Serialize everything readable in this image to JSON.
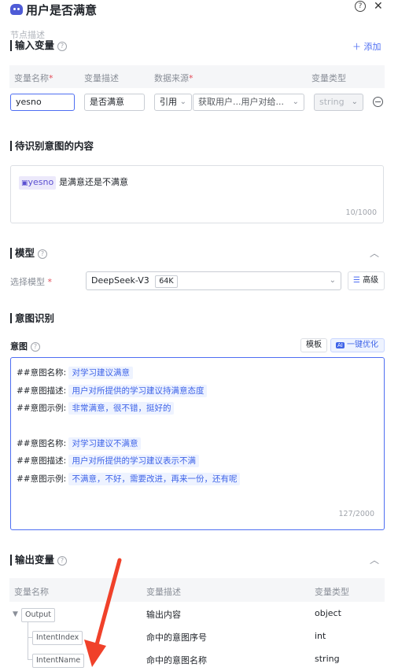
{
  "header": {
    "title": "用户是否满意",
    "subtitle": "节点描述",
    "help_icon": "question-circle-icon",
    "close_icon": "close-icon"
  },
  "input_section": {
    "title": "输入变量",
    "add_label": "添加",
    "columns": [
      "变量名称",
      "变量描述",
      "数据来源",
      "变量类型"
    ],
    "row": {
      "name": "yesno",
      "description": "是否满意",
      "source_mode": "引用",
      "source_value": "获取用户...用户对给...",
      "type_placeholder": "string"
    }
  },
  "query_section": {
    "title": "待识别意图的内容",
    "var_tag": "yesno",
    "text": "是满意还是不满意",
    "counter": "10/1000"
  },
  "model_section": {
    "title": "模型",
    "select_label": "选择模型",
    "model_name": "DeepSeek-V3",
    "context_badge": "64K",
    "advanced_label": "高级"
  },
  "intent_section": {
    "title": "意图识别",
    "intent_label": "意图",
    "template_btn": "模板",
    "optimize_btn": "一键优化",
    "ai_badge": "AI",
    "lines": [
      {
        "label": "##意图名称:",
        "value": "对学习建议满意"
      },
      {
        "label": "##意图描述:",
        "value": "用户对所提供的学习建议持满意态度"
      },
      {
        "label": "##意图示例:",
        "value": "非常满意，很不错，挺好的"
      },
      {
        "label": "##意图名称:",
        "value": "对学习建议不满意"
      },
      {
        "label": "##意图描述:",
        "value": "用户对所提供的学习建议表示不满"
      },
      {
        "label": "##意图示例:",
        "value": "不满意，不好，需要改进，再来一份，还有呢"
      }
    ],
    "counter": "127/2000"
  },
  "output_section": {
    "title": "输出变量",
    "columns": [
      "变量名称",
      "变量描述",
      "变量类型"
    ],
    "rows": [
      {
        "name": "Output",
        "description": "输出内容",
        "type": "object"
      },
      {
        "name": "IntentIndex",
        "description": "命中的意图序号",
        "type": "int"
      },
      {
        "name": "IntentName",
        "description": "命中的意图名称",
        "type": "string"
      }
    ]
  },
  "colors": {
    "accent": "#4e6ef2",
    "annotation_arrow": "#f0412a",
    "required": "#e34d59"
  }
}
